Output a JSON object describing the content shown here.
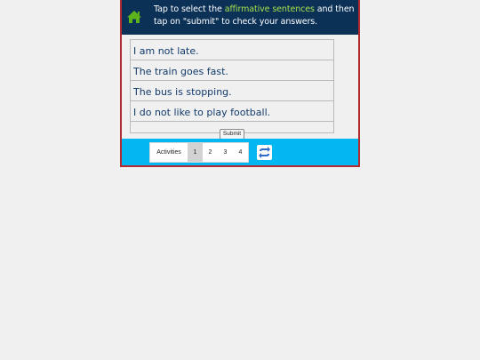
{
  "header": {
    "instruction_before": "Tap to select the ",
    "instruction_highlight": "affirmative sentences",
    "instruction_after": " and then tap on \"submit\" to check your answers.",
    "home_icon": "home-icon",
    "home_color": "#5cb31b",
    "background": "#0b3157",
    "highlight_color": "#a8e04a"
  },
  "sentences": [
    "I am not late.",
    "The train goes fast.",
    "The bus is stopping.",
    "I do not like to play football."
  ],
  "submit_label": "Submit",
  "footer": {
    "activities_label": "Activities",
    "pages": [
      "1",
      "2",
      "3",
      "4"
    ],
    "active_page": "1",
    "refresh_icon": "refresh-icon",
    "background": "#03b7f2",
    "refresh_color": "#2f6cc9"
  }
}
